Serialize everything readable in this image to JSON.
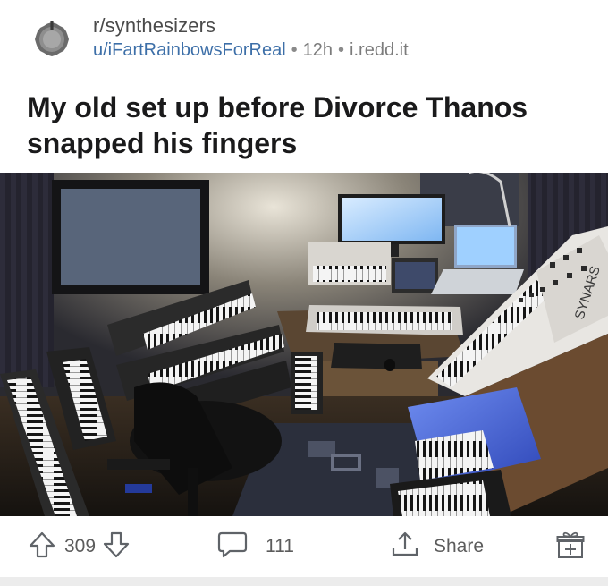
{
  "post": {
    "subreddit": "r/synthesizers",
    "author": "u/iFartRainbowsForReal",
    "age": "12h",
    "domain": "i.redd.it",
    "separator": "•",
    "title": "My old set up before Divorce Thanos snapped his fingers"
  },
  "image": {
    "synth_brand_label": "SYNARS"
  },
  "actions": {
    "upvote_count": "309",
    "comment_count": "111",
    "share_label": "Share"
  },
  "icons": {
    "subreddit": "synth-knob-icon",
    "upvote": "arrow-up-icon",
    "downvote": "arrow-down-icon",
    "comment": "speech-bubble-icon",
    "share": "share-upload-icon",
    "award": "gift-box-icon"
  },
  "colors": {
    "username": "#3d6fa8",
    "meta": "#7c7c7c",
    "icon": "#5f6368"
  }
}
